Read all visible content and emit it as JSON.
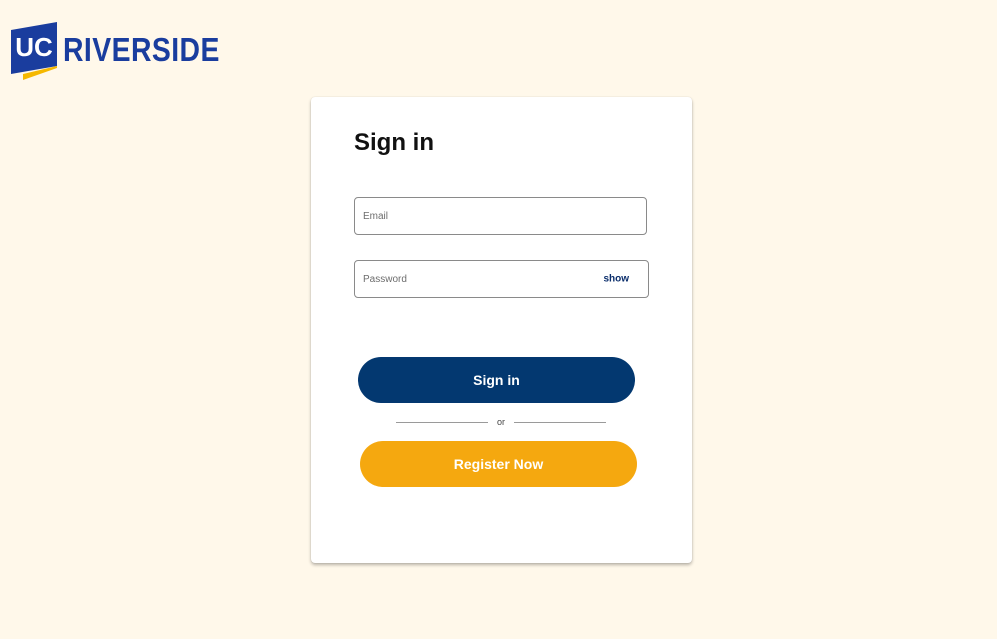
{
  "brand": {
    "logo_mark_text": "UC",
    "logo_word": "RIVERSIDE",
    "blue": "#1a3d9e",
    "gold": "#f5b800"
  },
  "signin_form": {
    "title": "Sign in",
    "email_placeholder": "Email",
    "password_placeholder": "Password",
    "show_password_label": "show",
    "submit_label": "Sign in",
    "divider_text": "or",
    "register_label": "Register Now"
  },
  "colors": {
    "page_background": "#fff8ea",
    "primary_button": "#033870",
    "secondary_button": "#f5a80f"
  }
}
